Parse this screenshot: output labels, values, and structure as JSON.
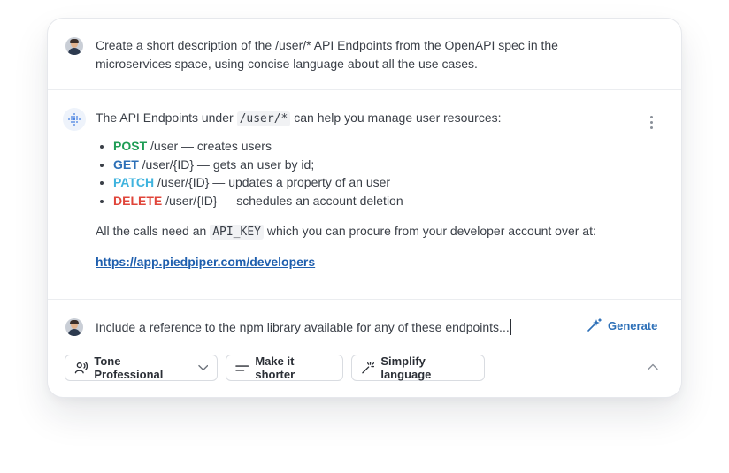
{
  "prompt": {
    "text": "Create a short description of the /user/* API Endpoints from the OpenAPI spec in the microservices space, using concise language about all the use cases."
  },
  "response": {
    "intro_before": "The API Endpoints under",
    "intro_code": "/user/*",
    "intro_after": "can help you manage user resources:",
    "methods": [
      {
        "method": "POST",
        "text": "/user — creates users"
      },
      {
        "method": "GET",
        "text": "/user/{ID} — gets an user by id;"
      },
      {
        "method": "PATCH",
        "text": "/user/{ID} — updates a property of an user"
      },
      {
        "method": "DELETE",
        "text": "/user/{ID} — schedules an account deletion"
      }
    ],
    "calls_before": "All the calls need an",
    "calls_code": "API_KEY",
    "calls_after": "which you can procure from your developer account over at:",
    "link": "https://app.piedpiper.com/developers"
  },
  "input": {
    "value": "Include a reference to the npm library available for any of these endpoints..."
  },
  "actions": {
    "generate": "Generate",
    "tone": "Tone Professional",
    "shorter": "Make it shorter",
    "simplify": "Simplify language"
  },
  "colors": {
    "post": "#1f9d55",
    "get": "#2c6fb7",
    "patch": "#3fb3de",
    "delete": "#e0453a",
    "link": "#1f5fae"
  },
  "icons": [
    "avatar",
    "ai-sparkle-icon",
    "kebab-menu-icon",
    "magic-wand-icon",
    "voice-icon",
    "chevron-down-icon",
    "text-lines-icon",
    "sparkle-wand-icon",
    "chevron-up-icon"
  ]
}
